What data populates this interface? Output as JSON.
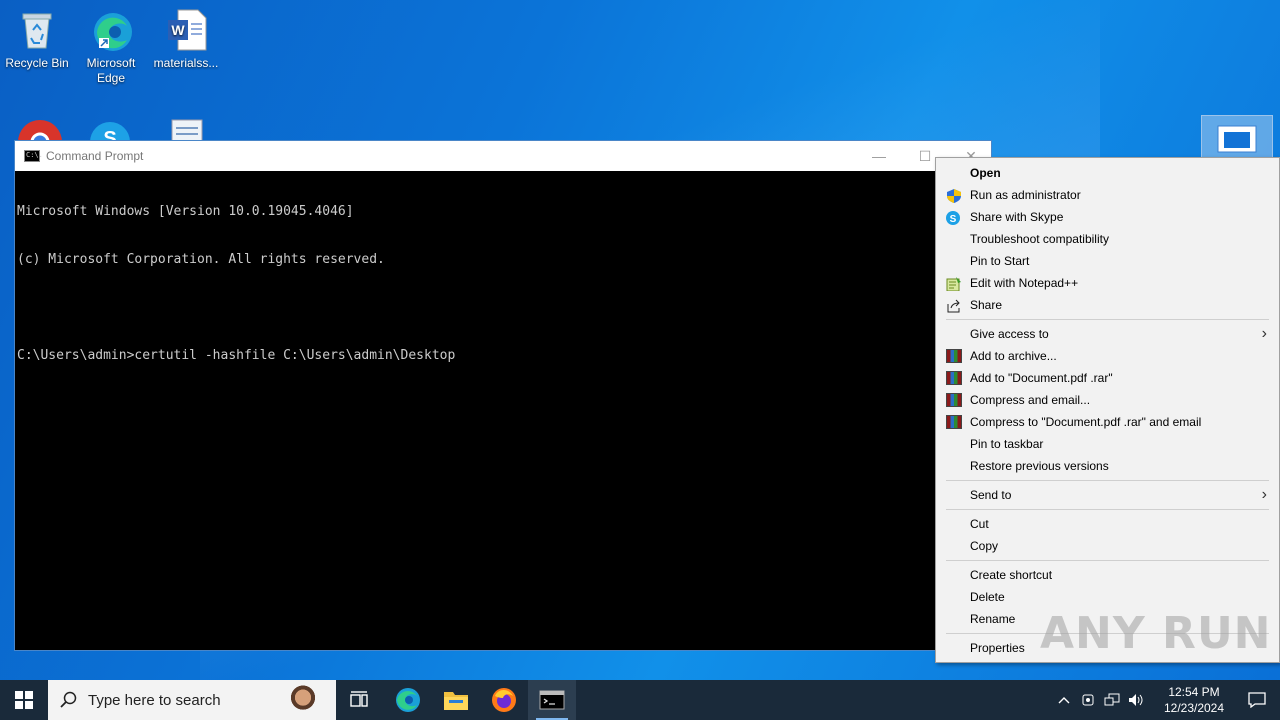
{
  "desktop": {
    "icons": [
      {
        "label": "Recycle Bin"
      },
      {
        "label": "Microsoft Edge"
      },
      {
        "label": "materialss..."
      }
    ]
  },
  "cmd": {
    "title": "Command Prompt",
    "title_icon_text": "C:\\.",
    "lines": [
      "Microsoft Windows [Version 10.0.19045.4046]",
      "(c) Microsoft Corporation. All rights reserved.",
      "",
      "C:\\Users\\admin>certutil -hashfile C:\\Users\\admin\\Desktop"
    ],
    "minimize": "—",
    "maximize": "☐",
    "close": "✕"
  },
  "context_menu": {
    "items": [
      {
        "label": "Open",
        "bold": true
      },
      {
        "label": "Run as administrator",
        "icon": "shield-icon"
      },
      {
        "label": "Share with Skype",
        "icon": "skype-icon"
      },
      {
        "label": "Troubleshoot compatibility"
      },
      {
        "label": "Pin to Start"
      },
      {
        "label": "Edit with Notepad++",
        "icon": "notepadpp-icon"
      },
      {
        "label": "Share",
        "icon": "share-icon"
      },
      {
        "label": "Give access to",
        "submenu": true
      },
      {
        "label": "Add to archive...",
        "icon": "winrar-icon"
      },
      {
        "label": "Add to \"Document.pdf .rar\"",
        "icon": "winrar-icon"
      },
      {
        "label": "Compress and email...",
        "icon": "winrar-icon"
      },
      {
        "label": "Compress to \"Document.pdf .rar\" and email",
        "icon": "winrar-icon"
      },
      {
        "label": "Pin to taskbar"
      },
      {
        "label": "Restore previous versions"
      },
      {
        "label": "Send to",
        "submenu": true
      },
      {
        "label": "Cut"
      },
      {
        "label": "Copy"
      },
      {
        "label": "Create shortcut"
      },
      {
        "label": "Delete"
      },
      {
        "label": "Rename"
      },
      {
        "label": "Properties"
      }
    ],
    "submenu_arrow": "›"
  },
  "watermark": "ANY RUN",
  "taskbar": {
    "search_placeholder": "Type here to search",
    "time": "12:54 PM",
    "date": "12/23/2024"
  },
  "colors": {
    "accent": "#0a74da",
    "taskbar": "#1a2a3a",
    "menu_bg": "#f2f2f2"
  }
}
